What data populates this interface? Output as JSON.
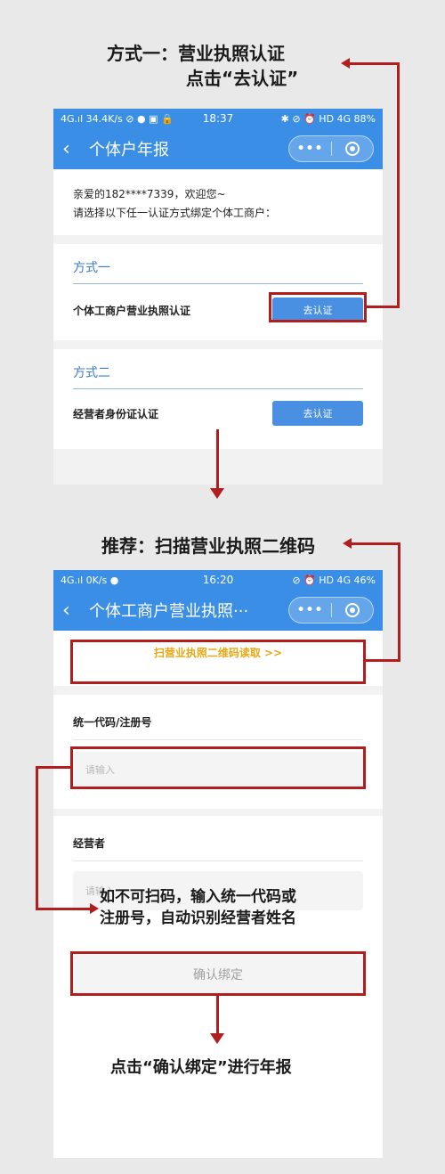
{
  "section1": {
    "caption_line1": "方式一：营业执照认证",
    "caption_line2": "点击“去认证”",
    "status": {
      "left": "4G.ıl 34.4K/s ⊘ ● ▣ 🔒",
      "time": "18:37",
      "right": "✱ ⊘ ⏰ HD 4G 88%"
    },
    "nav_title": "个体户年报",
    "greeting": "亲爱的182****7339，欢迎您~",
    "instruction": "请选择以下任一认证方式绑定个体工商户：",
    "method1": {
      "title": "方式一",
      "label": "个体工商户营业执照认证",
      "button": "去认证"
    },
    "method2": {
      "title": "方式二",
      "label": "经营者身份证认证",
      "button": "去认证"
    }
  },
  "section2": {
    "caption": "推荐：扫描营业执照二维码",
    "status": {
      "left": "4G.ıl 0K/s ●",
      "time": "16:20",
      "right": "⊘ ⏰ HD 4G 46%"
    },
    "nav_title": "个体工商户营业执照···",
    "scan_link": "扫营业执照二维码读取 >>",
    "code_label": "统一代码/注册号",
    "code_placeholder": "请输入",
    "operator_label": "经营者",
    "operator_placeholder": "请输入",
    "note_line1": "如不可扫码，输入统一代码或",
    "note_line2": "注册号，自动识别经营者姓名",
    "confirm_button": "确认绑定",
    "bottom_caption": "点击“确认绑定”进行年报"
  },
  "colors": {
    "accent": "#3a8ee6",
    "annotation_red": "#b01e1e",
    "scan_link": "#e6a817"
  }
}
